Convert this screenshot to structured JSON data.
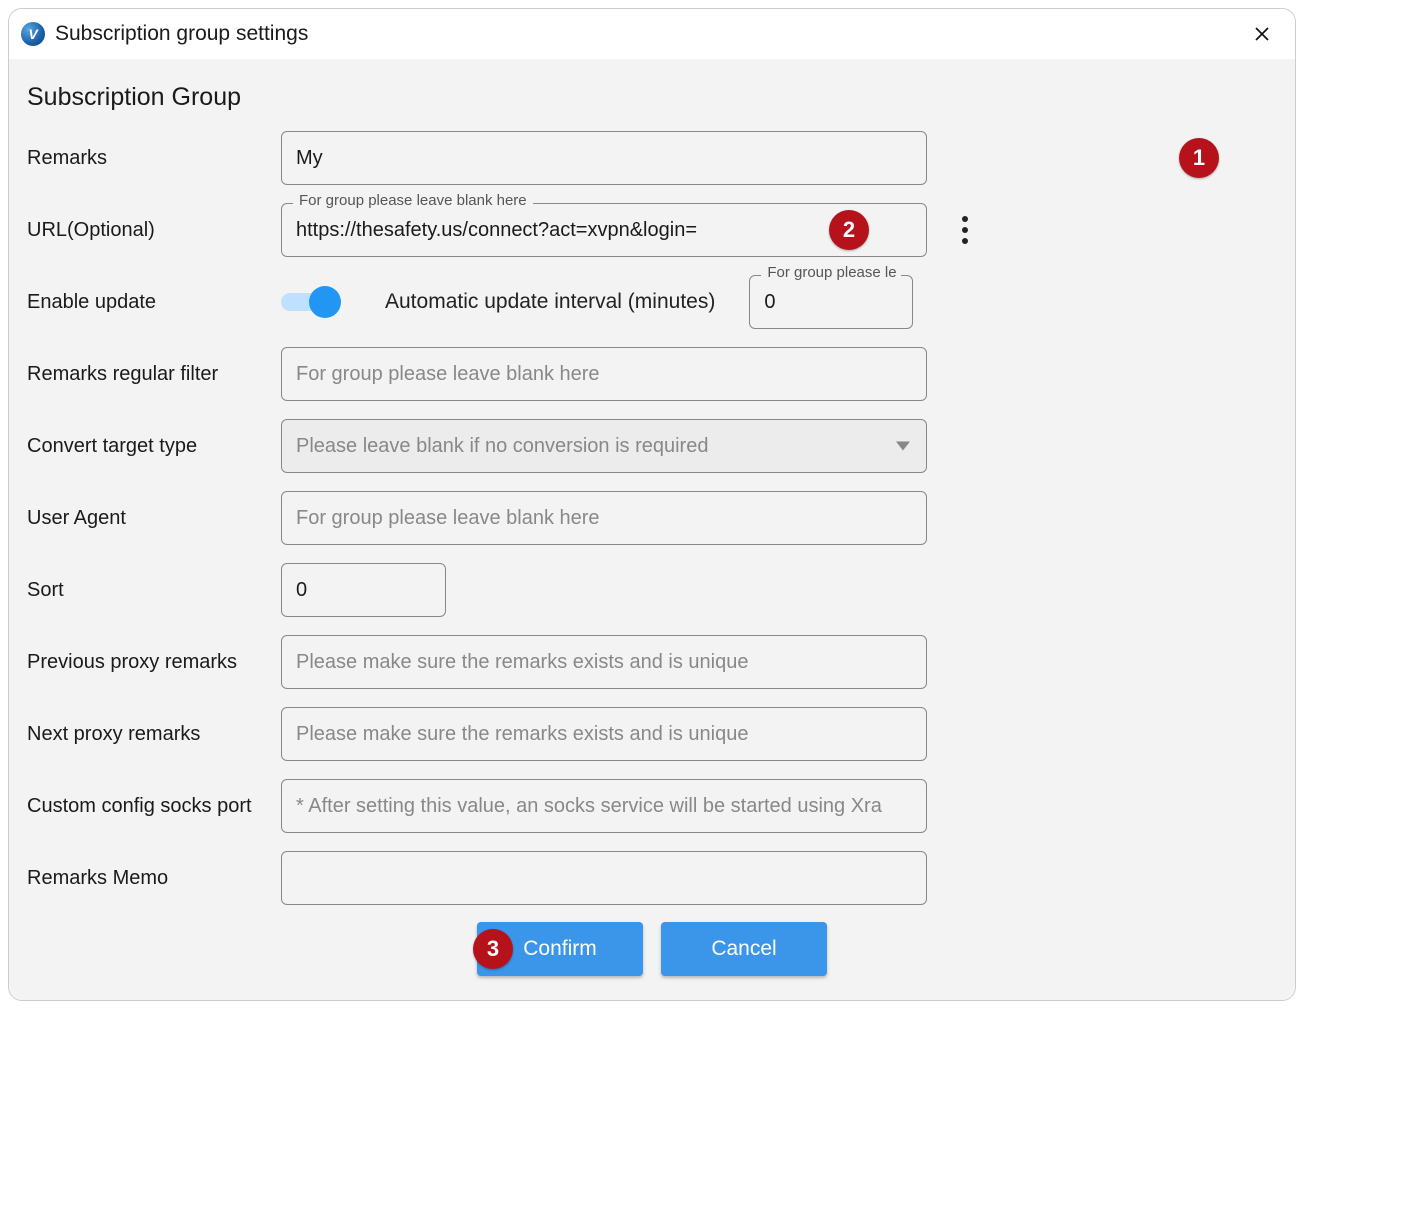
{
  "window": {
    "title": "Subscription group settings"
  },
  "section": {
    "title": "Subscription Group"
  },
  "fields": {
    "remarks": {
      "label": "Remarks",
      "value": "My"
    },
    "url": {
      "label": "URL(Optional)",
      "value": "https://thesafety.us/connect?act=xvpn&login=",
      "float": "For group please leave blank here"
    },
    "enable_update": {
      "label": "Enable update",
      "interval_label": "Automatic update interval (minutes)",
      "interval_value": "0",
      "interval_float": "For group please le"
    },
    "remarks_filter": {
      "label": "Remarks regular filter",
      "placeholder": "For group please leave blank here"
    },
    "convert_target": {
      "label": "Convert target type",
      "placeholder": "Please leave blank if no conversion is required"
    },
    "user_agent": {
      "label": "User Agent",
      "placeholder": "For group please leave blank here"
    },
    "sort": {
      "label": "Sort",
      "value": "0"
    },
    "prev_proxy": {
      "label": "Previous proxy remarks",
      "placeholder": "Please make sure the remarks exists and is unique"
    },
    "next_proxy": {
      "label": "Next proxy remarks",
      "placeholder": "Please make sure the remarks exists and is unique"
    },
    "socks_port": {
      "label": "Custom config socks port",
      "placeholder": "* After setting this value, an socks service will be started using Xra"
    },
    "memo": {
      "label": "Remarks Memo"
    }
  },
  "buttons": {
    "confirm": "Confirm",
    "cancel": "Cancel"
  },
  "annotations": {
    "a1": "1",
    "a2": "2",
    "a3": "3"
  }
}
